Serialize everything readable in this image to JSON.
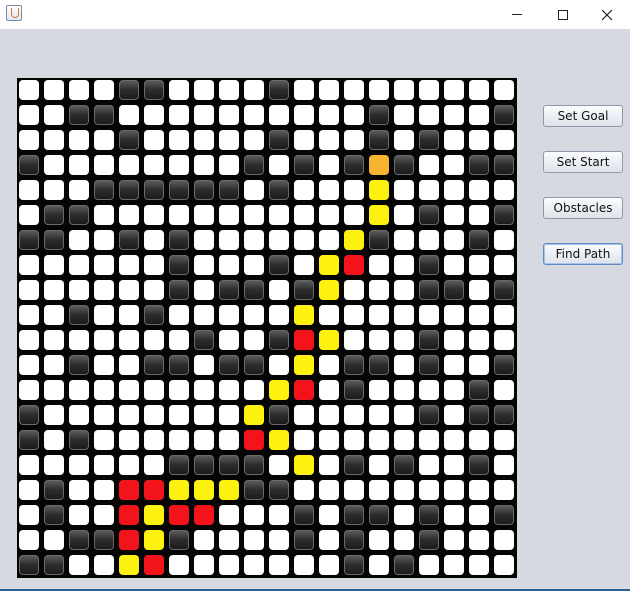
{
  "window": {
    "title": ""
  },
  "buttons": {
    "set_goal": "Set Goal",
    "set_start": "Set Start",
    "obstacles": "Obstacles",
    "find_path": "Find Path"
  },
  "grid": {
    "rows": 20,
    "cols": 20,
    "legend": {
      ".": "empty",
      "#": "wall",
      "Y": "path",
      "R": "visited",
      "G": "goal"
    },
    "cells": [
      "....##....#.........",
      "..##..........#....#",
      "....#.....#...#.#...",
      "#........#.#.#G#..##",
      "...######.#...Y.....",
      ".##...........Y.#..#",
      "##..#.#......Y#...#.",
      "......#...#.YR..#...",
      "......#.##.#Y...##.#",
      "..#..#.....Y........",
      ".......#..#RY...#...",
      "..#..##.##.Y.##.#..#",
      "..........YR.#....#.",
      "#........Y#.....#.##",
      "#.#......RY.........",
      "......####.Y.#.#..#.",
      ".#..RRYYY##.........",
      ".#..RYRR...#.##.#..#",
      "..##RY#....#.#..#...",
      "##..YR.......#.#...."
    ]
  },
  "colors": {
    "window_bg": "#d6d9df",
    "board_bg": "#050505",
    "empty": "#ffffff",
    "wall": "#2d2d2d",
    "path": "#fdf20f",
    "visited": "#f3141b",
    "goal": "#f6b430",
    "accent": "#2c5f9b"
  },
  "icons": {
    "app": "java-cup-icon",
    "minimize": "minimize-icon",
    "maximize": "maximize-icon",
    "close": "close-icon"
  }
}
